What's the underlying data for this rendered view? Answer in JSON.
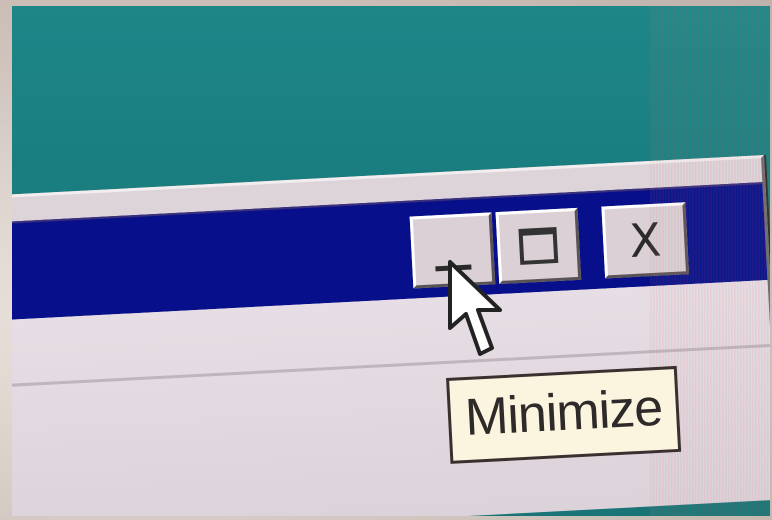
{
  "desktop": {
    "background_color": "#197b7d"
  },
  "window": {
    "titlebar_color": "#07108a",
    "buttons": [
      {
        "id": "minimize",
        "icon": "minimize-icon"
      },
      {
        "id": "maximize",
        "icon": "maximize-icon"
      },
      {
        "id": "close",
        "icon": "close-icon",
        "glyph": "X"
      }
    ]
  },
  "tooltip": {
    "text": "Minimize",
    "background_color": "#fbf4de"
  },
  "cursor": {
    "icon": "arrow-cursor-icon"
  }
}
